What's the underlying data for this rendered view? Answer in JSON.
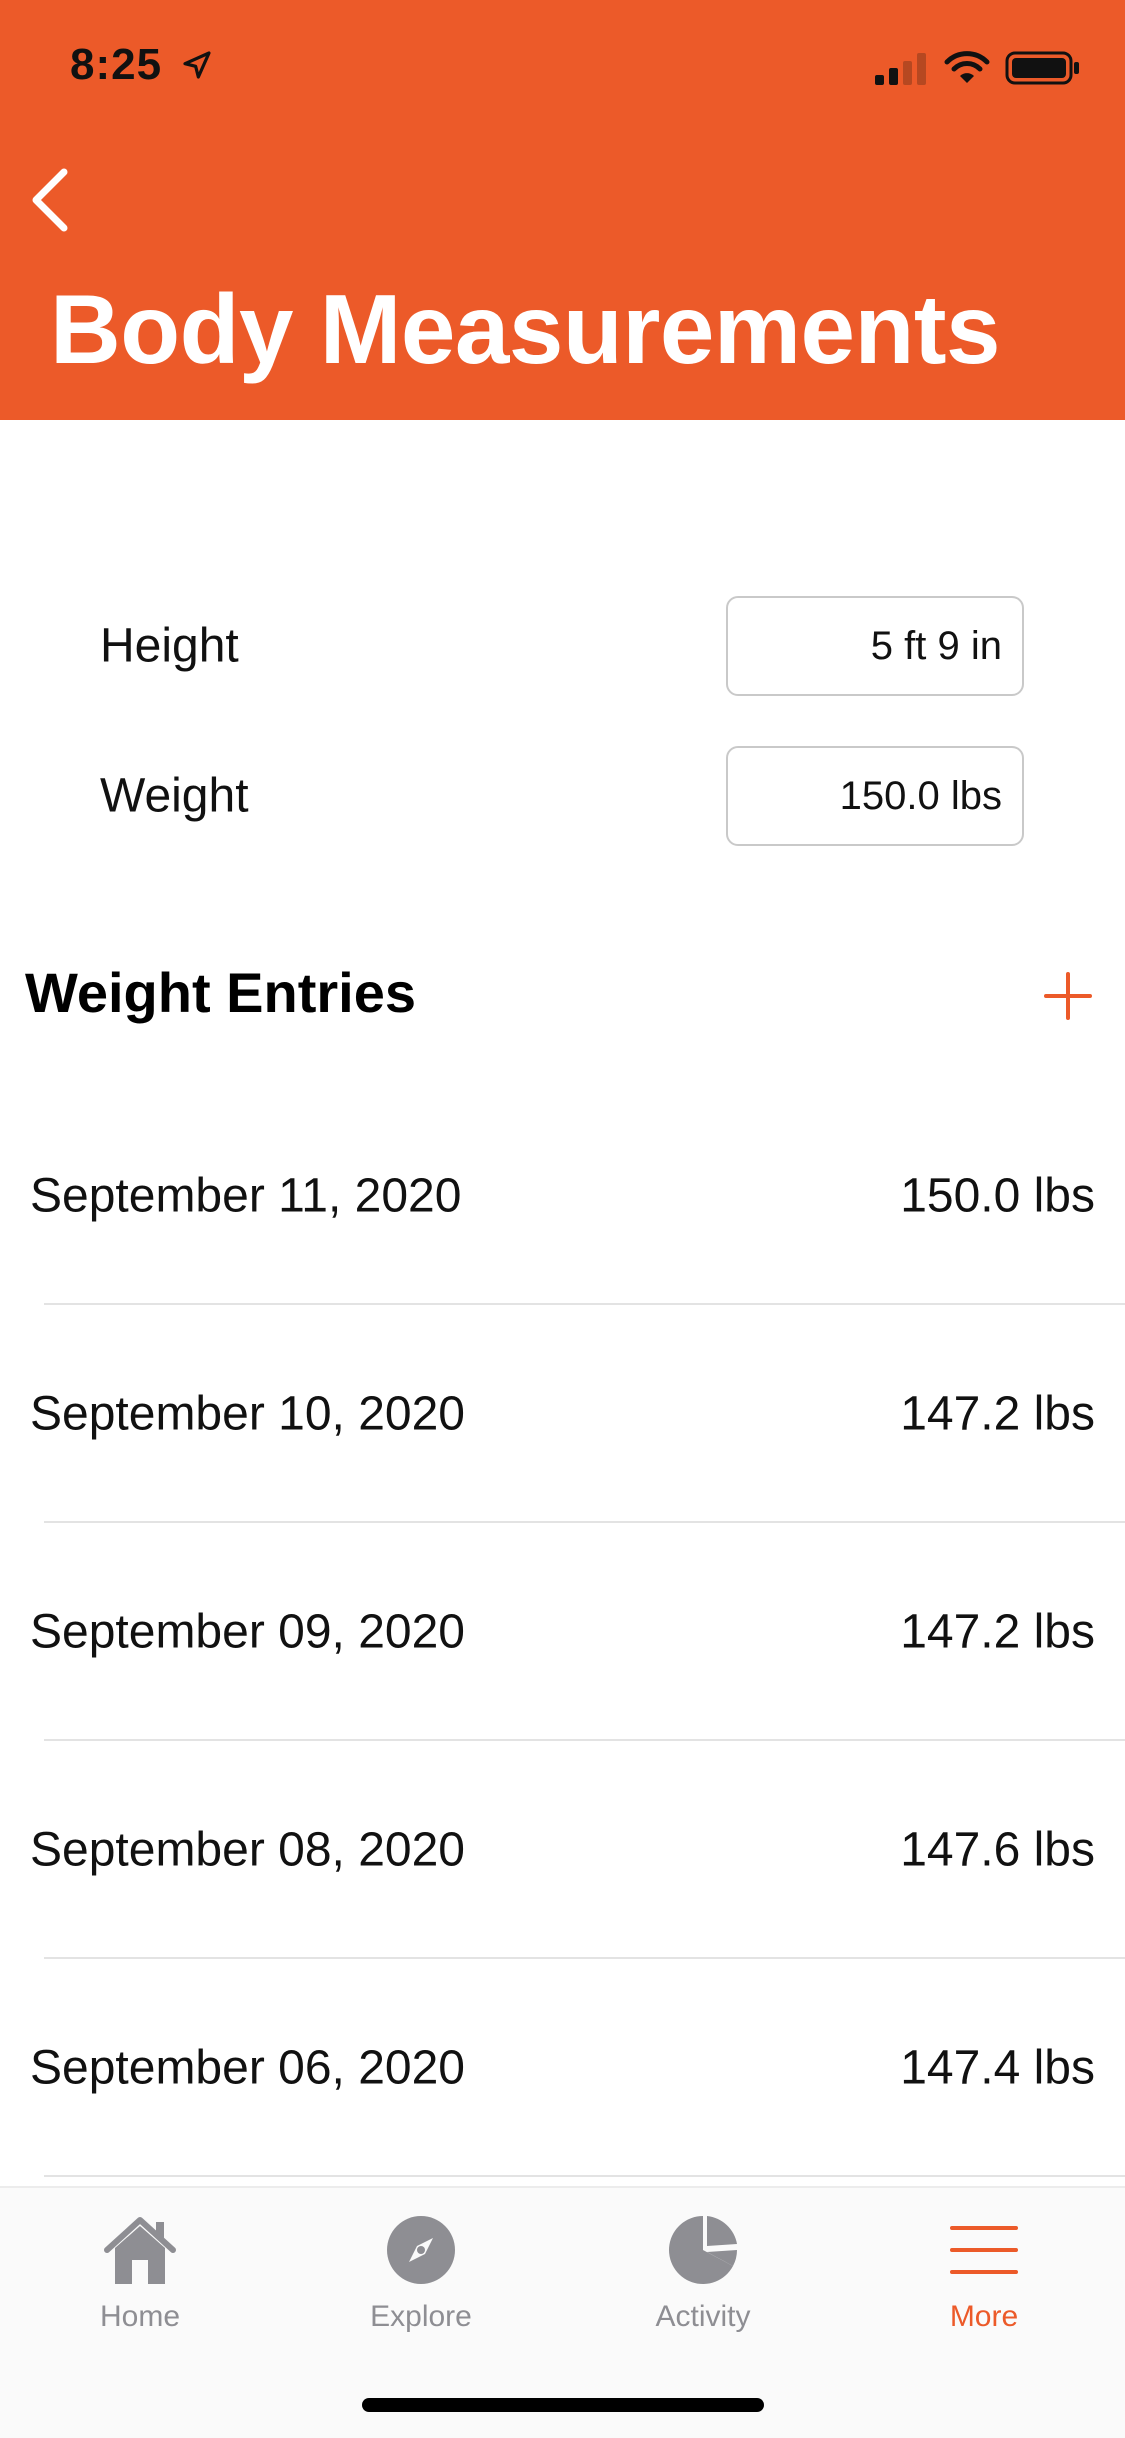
{
  "status_bar": {
    "time": "8:25"
  },
  "header": {
    "title": "Body Measurements"
  },
  "profile": {
    "height_label": "Height",
    "height_value": "5 ft 9 in",
    "weight_label": "Weight",
    "weight_value": "150.0 lbs"
  },
  "entries_section": {
    "title": "Weight Entries",
    "items": [
      {
        "date": "September 11, 2020",
        "weight": "150.0 lbs"
      },
      {
        "date": "September 10, 2020",
        "weight": "147.2 lbs"
      },
      {
        "date": "September 09, 2020",
        "weight": "147.2 lbs"
      },
      {
        "date": "September 08, 2020",
        "weight": "147.6 lbs"
      },
      {
        "date": "September 06, 2020",
        "weight": "147.4 lbs"
      }
    ]
  },
  "tabbar": {
    "tabs": [
      {
        "label": "Home",
        "icon": "house-icon",
        "active": false
      },
      {
        "label": "Explore",
        "icon": "compass-icon",
        "active": false
      },
      {
        "label": "Activity",
        "icon": "pie-chart-icon",
        "active": false
      },
      {
        "label": "More",
        "icon": "hamburger-menu-icon",
        "active": true
      }
    ]
  },
  "colors": {
    "accent": "#EC5A29",
    "inactive": "#8e8e93"
  }
}
